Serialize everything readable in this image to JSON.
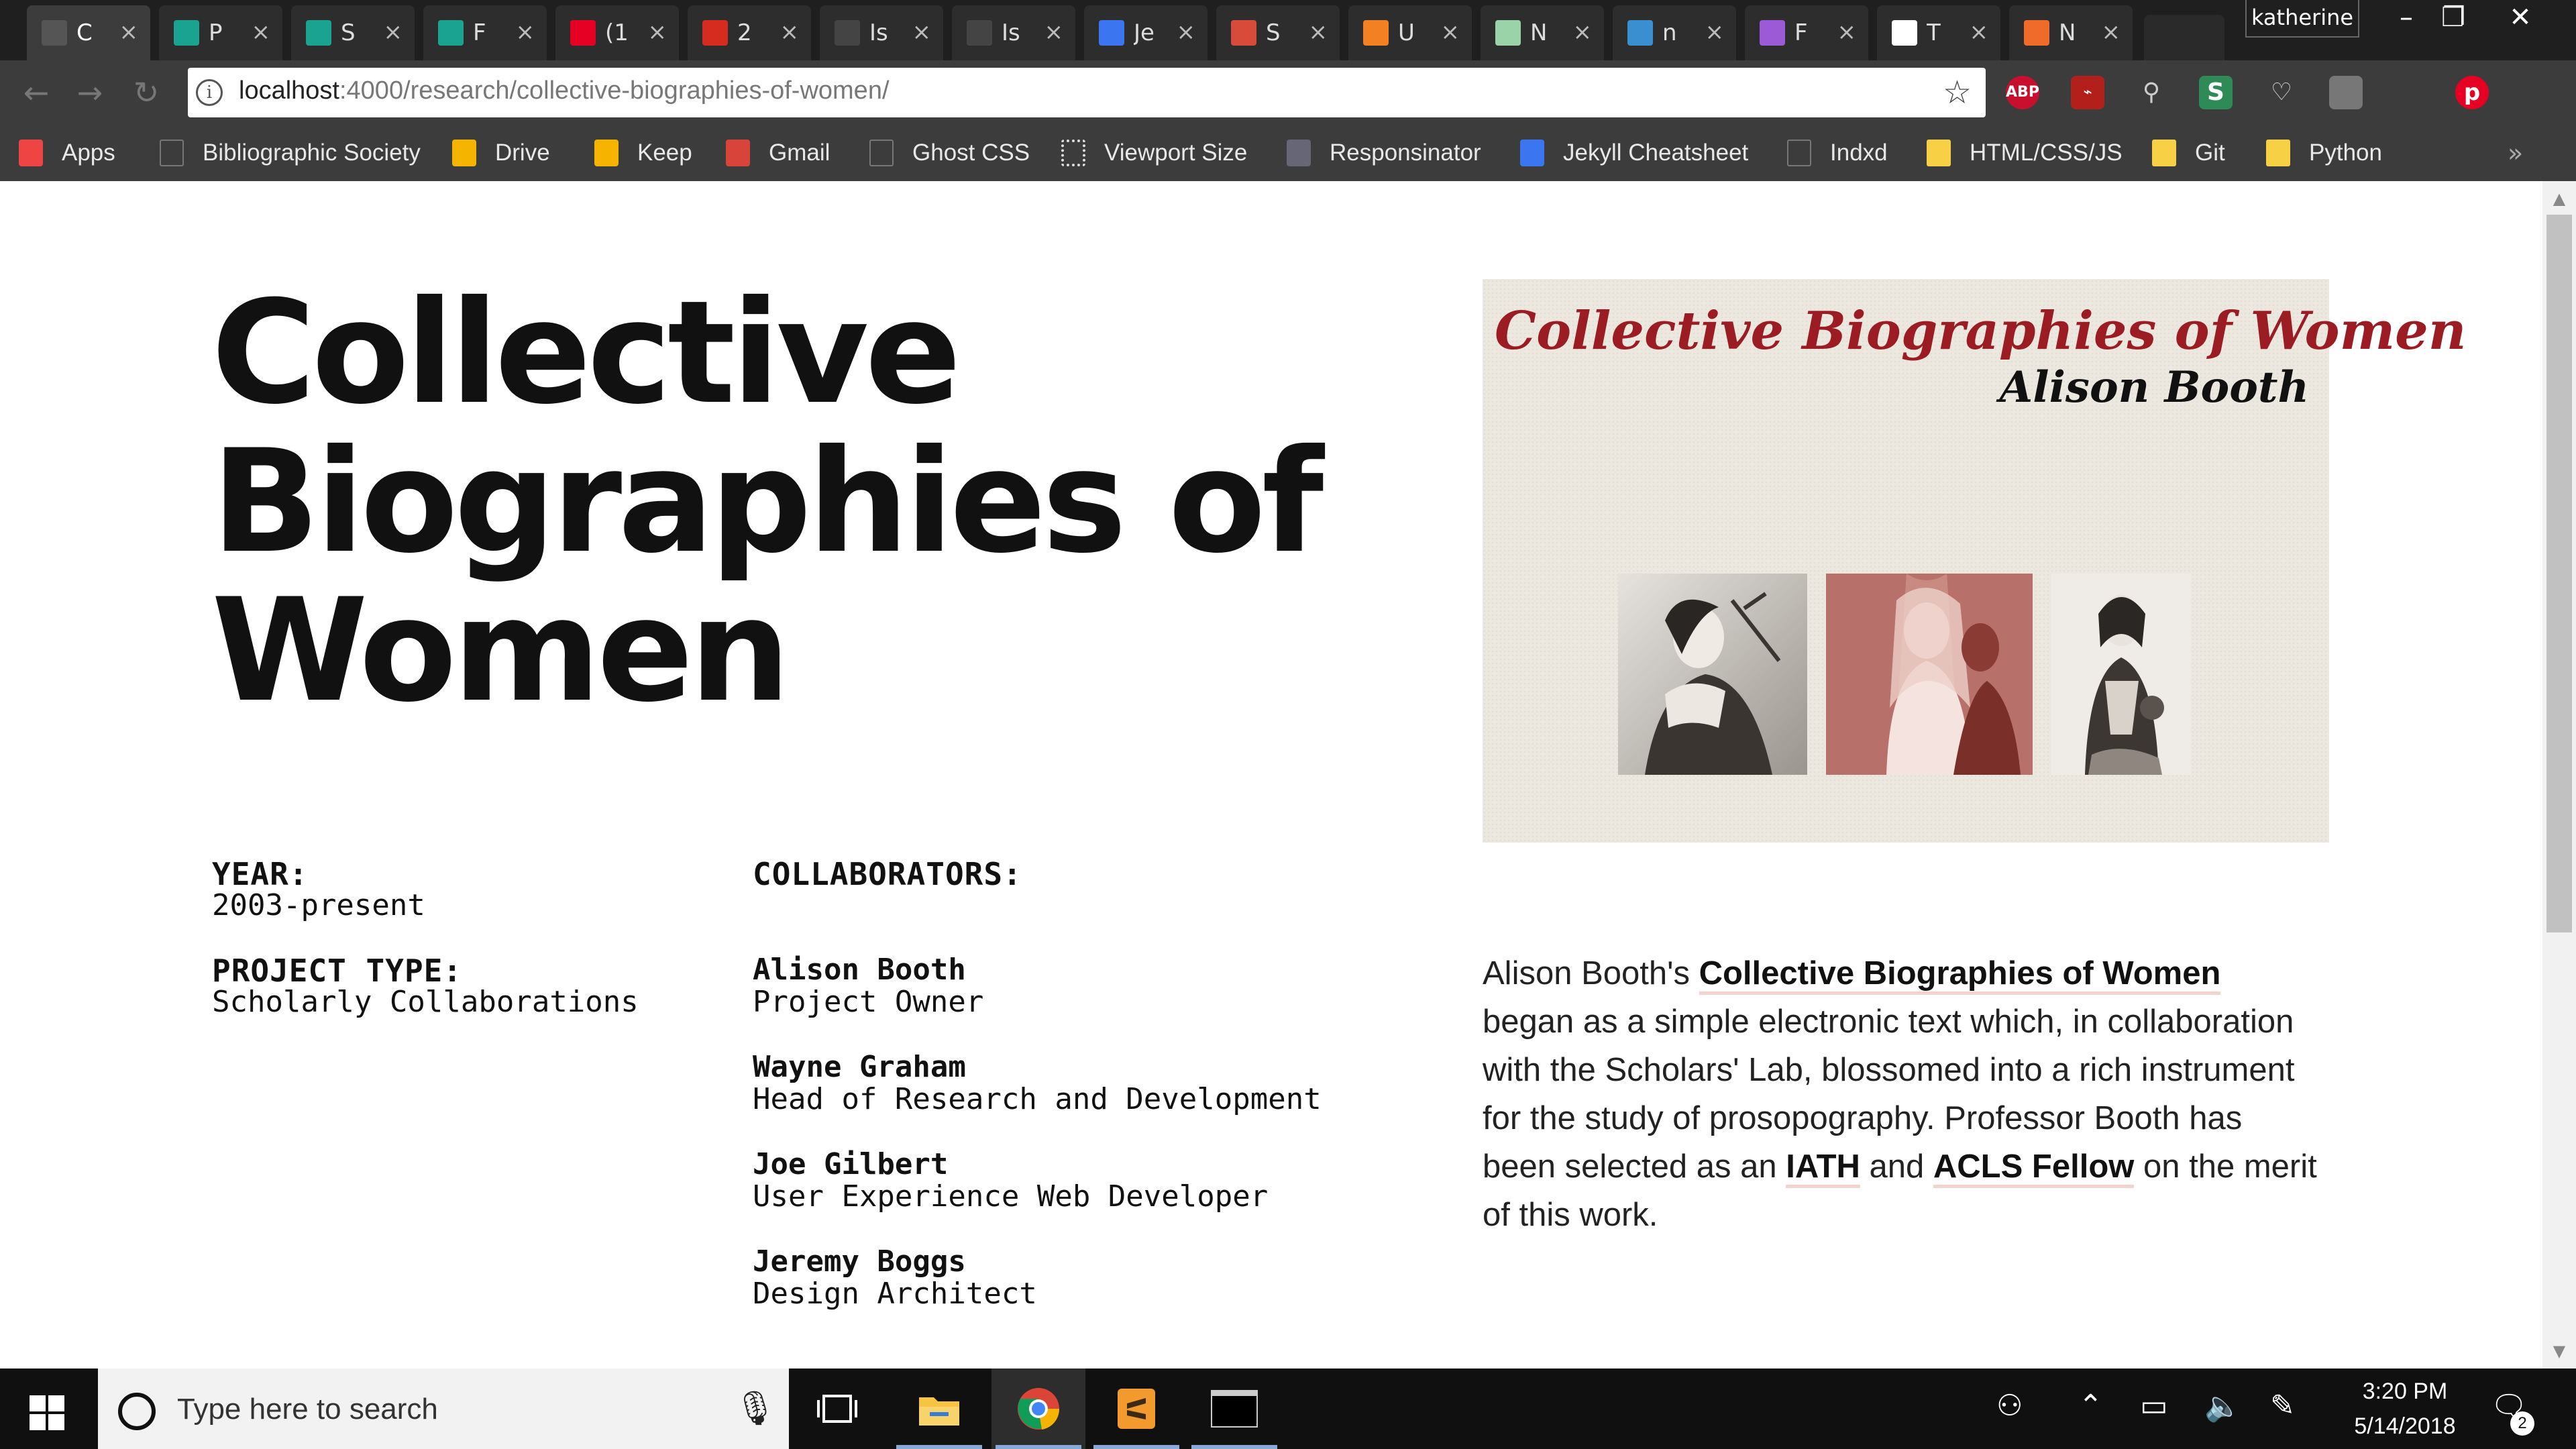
{
  "browser": {
    "tabs": [
      {
        "title": "C",
        "favicon": "document-icon",
        "color": "#555555",
        "active": true
      },
      {
        "title": "P",
        "favicon": "teal-square-icon",
        "color": "#1aa391"
      },
      {
        "title": "S",
        "favicon": "teal-square-icon",
        "color": "#1aa391"
      },
      {
        "title": "F",
        "favicon": "teal-square-icon",
        "color": "#1aa391"
      },
      {
        "title": "(1",
        "favicon": "pinterest-icon",
        "color": "#e60023"
      },
      {
        "title": "2",
        "favicon": "w-icon",
        "color": "#d62b1f"
      },
      {
        "title": "Is",
        "favicon": "github-icon",
        "color": "#444444"
      },
      {
        "title": "Is",
        "favicon": "github-icon",
        "color": "#444444"
      },
      {
        "title": "Je",
        "favicon": "jekyll-icon",
        "color": "#3b76f0"
      },
      {
        "title": "S",
        "favicon": "pencil-icon",
        "color": "#d84a3a"
      },
      {
        "title": "U",
        "favicon": "stackoverflow-icon",
        "color": "#f48024"
      },
      {
        "title": "N",
        "favicon": "green-square-icon",
        "color": "#9bd3a8"
      },
      {
        "title": "n",
        "favicon": "n-icon",
        "color": "#3a8fd1"
      },
      {
        "title": "F",
        "favicon": "diamond-icon",
        "color": "#9c5ad6"
      },
      {
        "title": "T",
        "favicon": "medium-icon",
        "color": "#ffffff"
      },
      {
        "title": "N",
        "favicon": "c-icon",
        "color": "#f06a2a"
      }
    ],
    "user": "katherine",
    "url_host": "localhost",
    "url_path": ":4000/research/collective-biographies-of-women/",
    "extensions": [
      "ABP",
      "PDF",
      "lens",
      "S",
      "bulb",
      "box",
      "pin"
    ],
    "bookmarks": [
      {
        "label": "Apps",
        "icon": "apps-grid-icon"
      },
      {
        "label": "Bibliographic Society",
        "icon": "document-icon"
      },
      {
        "label": "Drive",
        "icon": "drive-icon"
      },
      {
        "label": "Keep",
        "icon": "keep-icon"
      },
      {
        "label": "Gmail",
        "icon": "gmail-icon"
      },
      {
        "label": "Ghost CSS",
        "icon": "document-icon"
      },
      {
        "label": "Viewport Size",
        "icon": "viewport-icon"
      },
      {
        "label": "Responsinator",
        "icon": "r-icon"
      },
      {
        "label": "Jekyll Cheatsheet",
        "icon": "jekyll-icon"
      },
      {
        "label": "Indxd",
        "icon": "document-icon"
      },
      {
        "label": "HTML/CSS/JS",
        "icon": "folder-icon"
      },
      {
        "label": "Git",
        "icon": "folder-icon"
      },
      {
        "label": "Python",
        "icon": "folder-icon"
      }
    ]
  },
  "page": {
    "title": "Collective Biographies of Women",
    "year_label": "YEAR:",
    "year_value": "2003-present",
    "type_label": "PROJECT TYPE:",
    "type_value": "Scholarly Collaborations",
    "collaborators_label": "COLLABORATORS:",
    "collaborators": [
      {
        "name": "Alison Booth",
        "role": "Project Owner"
      },
      {
        "name": "Wayne Graham",
        "role": "Head of Research and Development"
      },
      {
        "name": "Joe Gilbert",
        "role": "User Experience Web Developer"
      },
      {
        "name": "Jeremy Boggs",
        "role": "Design Architect"
      }
    ],
    "hero_title": "Collective Biographies of Women",
    "hero_author": "Alison Booth",
    "desc_pre": "Alison Booth's ",
    "desc_link1": "Collective Biographies of Women",
    "desc_mid": " began as a simple electronic text which, in collaboration with the Scholars' Lab, blossomed into a rich instrument for the study of prosopography. Professor Booth has been selected as an ",
    "desc_link2": "IATH",
    "desc_and": " and ",
    "desc_link3": "ACLS Fellow",
    "desc_post": " on the merit of this work."
  },
  "taskbar": {
    "search_placeholder": "Type here to search",
    "time": "3:20 PM",
    "date": "5/14/2018",
    "notification_count": "2"
  }
}
